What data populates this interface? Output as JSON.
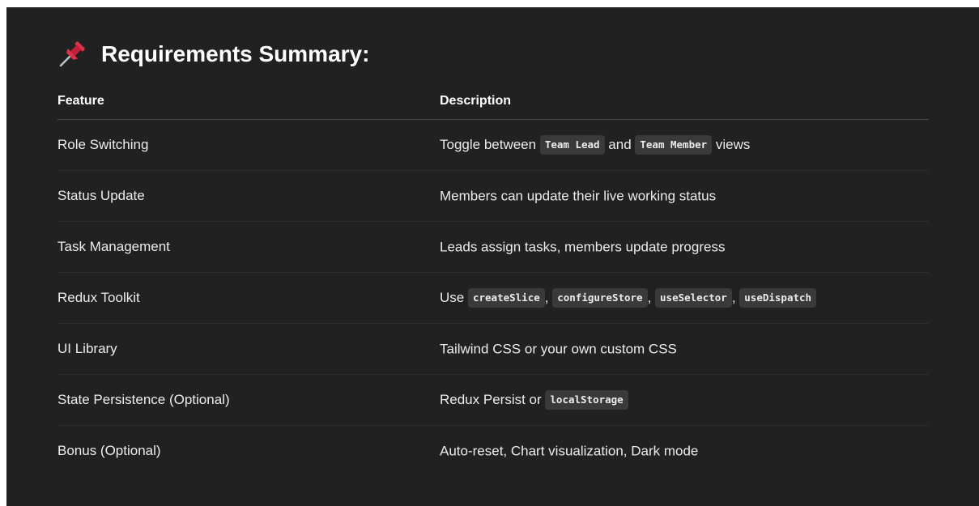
{
  "heading": {
    "icon": "pushpin-icon",
    "title": "Requirements Summary:"
  },
  "table": {
    "headers": [
      "Feature",
      "Description"
    ],
    "rows": [
      {
        "feature": "Role Switching",
        "parts": [
          {
            "text": "Toggle between "
          },
          {
            "code": "Team Lead"
          },
          {
            "text": " and "
          },
          {
            "code": "Team Member"
          },
          {
            "text": " views"
          }
        ]
      },
      {
        "feature": "Status Update",
        "parts": [
          {
            "text": "Members can update their live working status"
          }
        ]
      },
      {
        "feature": "Task Management",
        "parts": [
          {
            "text": "Leads assign tasks, members update progress"
          }
        ]
      },
      {
        "feature": "Redux Toolkit",
        "parts": [
          {
            "text": "Use "
          },
          {
            "code": "createSlice"
          },
          {
            "text": ", "
          },
          {
            "code": "configureStore"
          },
          {
            "text": ", "
          },
          {
            "code": "useSelector"
          },
          {
            "text": ", "
          },
          {
            "code": "useDispatch"
          }
        ]
      },
      {
        "feature": "UI Library",
        "parts": [
          {
            "text": "Tailwind CSS or your own custom CSS"
          }
        ]
      },
      {
        "feature": "State Persistence (Optional)",
        "parts": [
          {
            "text": "Redux Persist or "
          },
          {
            "code": "localStorage"
          }
        ]
      },
      {
        "feature": "Bonus (Optional)",
        "parts": [
          {
            "text": "Auto-reset, Chart visualization, Dark mode"
          }
        ]
      }
    ]
  },
  "colors": {
    "background": "#212121",
    "text": "#ececec",
    "code_bg": "#3a3a3a",
    "pin_red": "#e0304a"
  }
}
